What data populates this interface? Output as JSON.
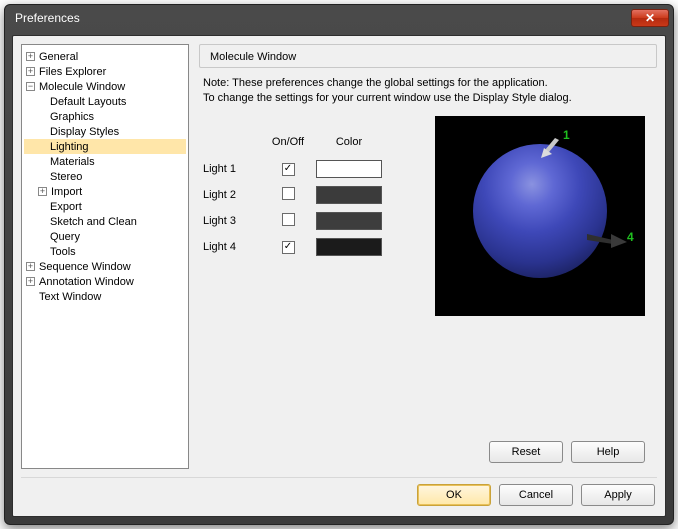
{
  "window": {
    "title": "Preferences"
  },
  "tree": {
    "general": "General",
    "files_explorer": "Files Explorer",
    "molecule_window": "Molecule Window",
    "default_layouts": "Default Layouts",
    "graphics": "Graphics",
    "display_styles": "Display Styles",
    "lighting": "Lighting",
    "materials": "Materials",
    "stereo": "Stereo",
    "import": "Import",
    "export": "Export",
    "sketch_and_clean": "Sketch and Clean",
    "query": "Query",
    "tools": "Tools",
    "sequence_window": "Sequence Window",
    "annotation_window": "Annotation Window",
    "text_window": "Text Window"
  },
  "panel": {
    "title": "Molecule Window",
    "note_line1": "Note: These preferences change the global settings for the application.",
    "note_line2": "To change the settings for your current window use the Display Style dialog."
  },
  "lights": {
    "header_onoff": "On/Off",
    "header_color": "Color",
    "rows": [
      {
        "name": "Light 1",
        "on": true,
        "color": "#ffffff"
      },
      {
        "name": "Light 2",
        "on": false,
        "color": "#3b3b3b"
      },
      {
        "name": "Light 3",
        "on": false,
        "color": "#3d3d3d"
      },
      {
        "name": "Light 4",
        "on": true,
        "color": "#1b1b1b"
      }
    ],
    "labels": {
      "l1": "1",
      "l4": "4"
    }
  },
  "buttons": {
    "reset": "Reset",
    "help": "Help",
    "ok": "OK",
    "cancel": "Cancel",
    "apply": "Apply"
  }
}
